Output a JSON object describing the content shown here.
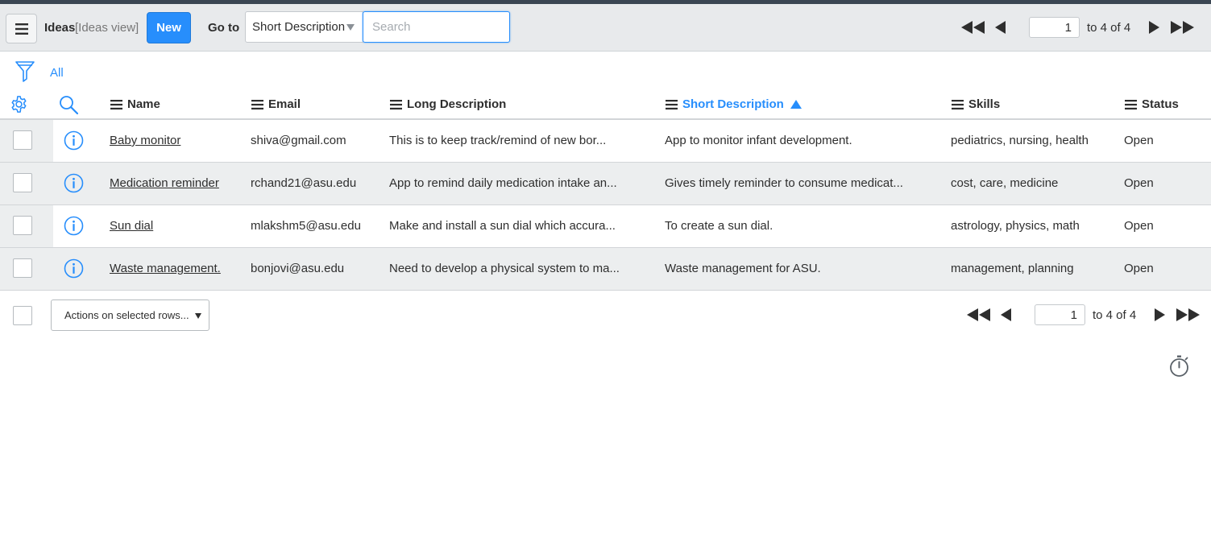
{
  "toolbar": {
    "title": "Ideas",
    "view": "[Ideas view]",
    "new_label": "New",
    "goto_label": "Go to",
    "field_selected": "Short Description",
    "search_placeholder": "Search"
  },
  "pager": {
    "page": "1",
    "range_text": "to 4 of 4"
  },
  "filter": {
    "label": "All"
  },
  "columns": [
    {
      "label": "Name"
    },
    {
      "label": "Email"
    },
    {
      "label": "Long Description"
    },
    {
      "label": "Short Description",
      "sorted": "ascending"
    },
    {
      "label": "Skills"
    },
    {
      "label": "Status"
    }
  ],
  "rows": [
    {
      "name": "Baby monitor",
      "email": "shiva@gmail.com",
      "long_description": "This is to keep track/remind of new bor...",
      "short_description": "App to monitor infant development.",
      "skills": "pediatrics, nursing, health",
      "status": "Open"
    },
    {
      "name": "Medication reminder",
      "email": "rchand21@asu.edu",
      "long_description": "App to remind daily medication intake an...",
      "short_description": "Gives timely reminder to consume medicat...",
      "skills": "cost, care, medicine",
      "status": "Open"
    },
    {
      "name": "Sun dial",
      "email": "mlakshm5@asu.edu",
      "long_description": "Make and install a sun dial which accura...",
      "short_description": "To create a sun dial.",
      "skills": "astrology, physics, math",
      "status": "Open"
    },
    {
      "name": "Waste management.",
      "email": "bonjovi@asu.edu",
      "long_description": "Need to develop a physical system to ma...",
      "short_description": "Waste management for ASU.",
      "skills": "management, planning",
      "status": "Open"
    }
  ],
  "footer": {
    "actions_label": "Actions on selected rows...",
    "page": "1",
    "range_text": "to 4 of 4"
  },
  "colors": {
    "accent": "#278efc",
    "toolbar_bg": "#e8eaec",
    "alt_row_bg": "#eceeef",
    "top_strip": "#3b4653"
  },
  "icons": [
    "hamburger-menu-icon",
    "filter-funnel-icon",
    "gear-icon",
    "search-icon",
    "info-icon",
    "first-page-icon",
    "prev-page-icon",
    "next-page-icon",
    "last-page-icon",
    "timer-icon"
  ]
}
